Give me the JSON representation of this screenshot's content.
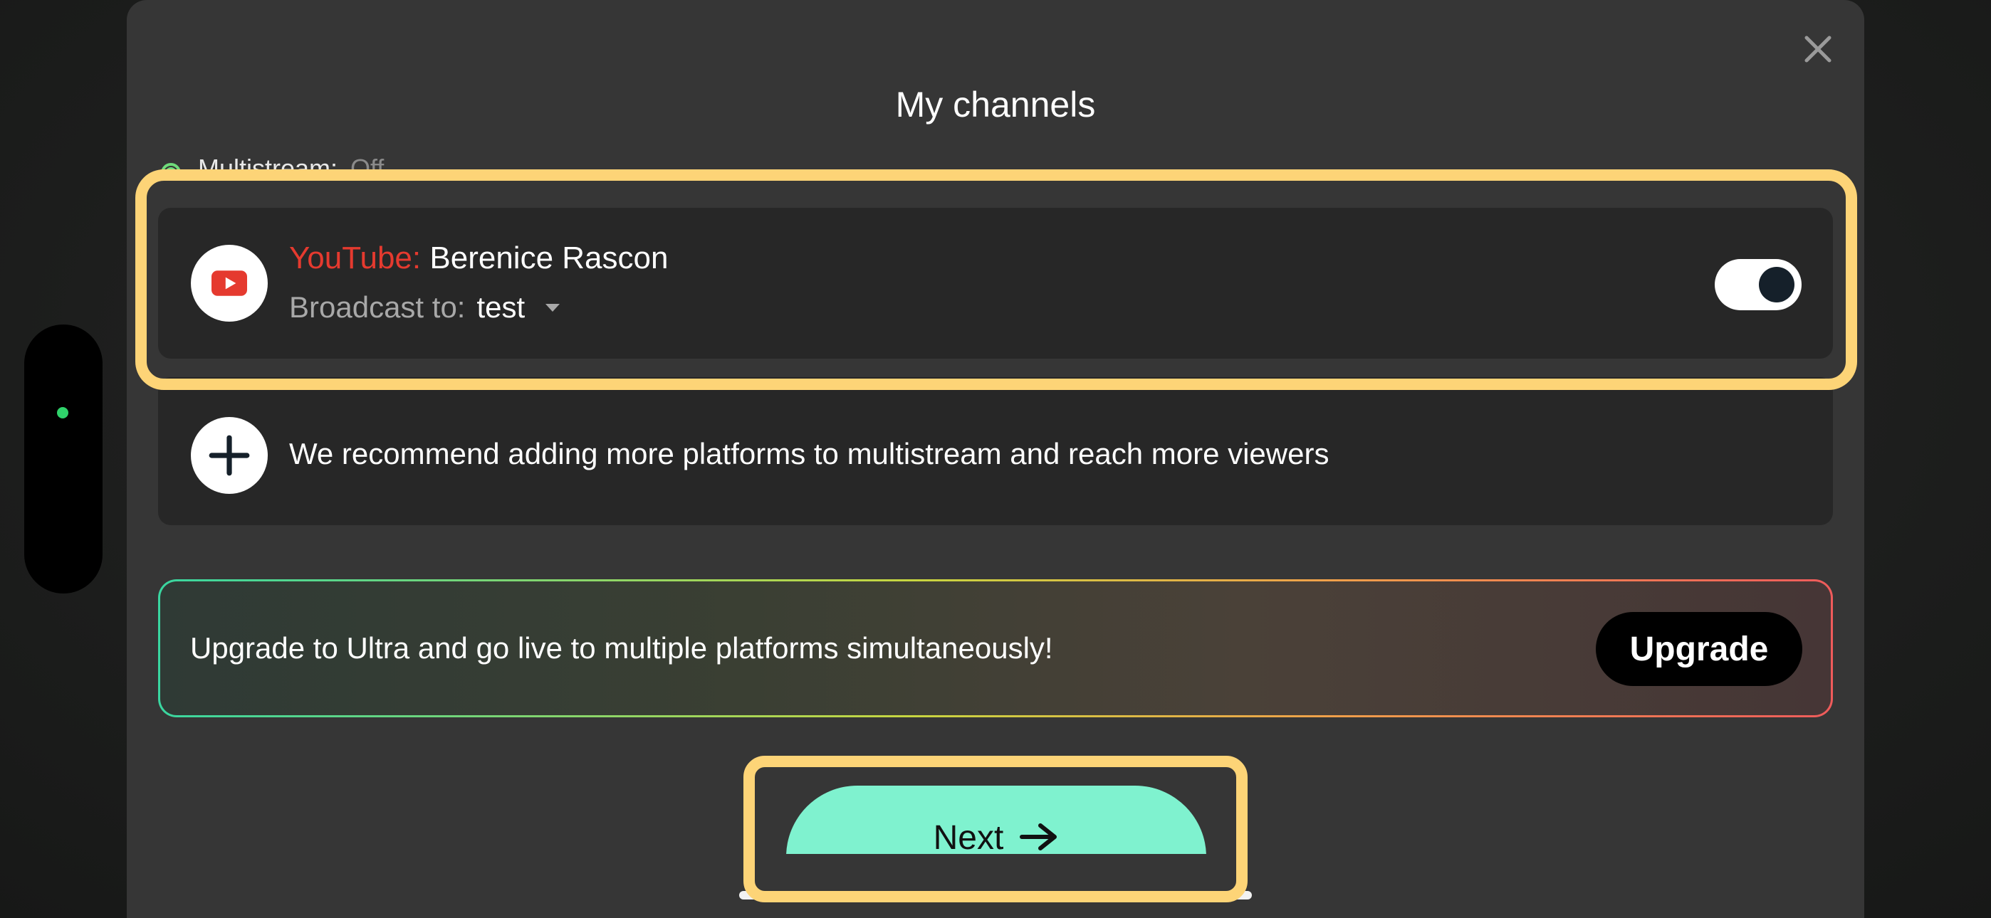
{
  "modal": {
    "title": "My channels",
    "multistream_label": "Multistream:",
    "multistream_value": "Off"
  },
  "channel": {
    "platform_label": "YouTube:",
    "account_name": "Berenice Rascon",
    "broadcast_label": "Broadcast to:",
    "broadcast_value": "test",
    "enabled": true,
    "icon": "youtube-icon"
  },
  "add_platform": {
    "text": "We recommend adding more platforms to multistream and reach more viewers",
    "icon": "plus-icon"
  },
  "upgrade_banner": {
    "text": "Upgrade to Ultra and go live to multiple platforms simultaneously!",
    "button_label": "Upgrade"
  },
  "footer": {
    "next_label": "Next",
    "next_icon": "arrow-right-icon"
  },
  "colors": {
    "youtube_red": "#e53a2f",
    "accent": "#7ff2cf",
    "highlight": "#fdd477",
    "status_green": "#2fd36b"
  }
}
